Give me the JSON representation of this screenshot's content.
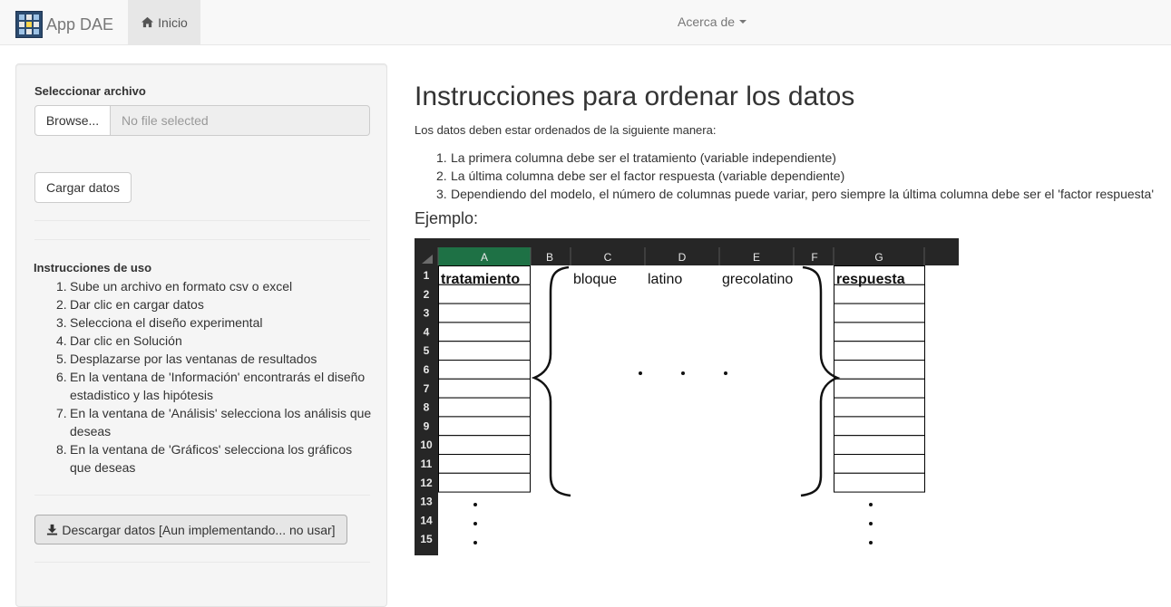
{
  "navbar": {
    "brand": "App DAE",
    "home_label": "Inicio",
    "about_label": "Acerca de",
    "home_icon": "home-icon",
    "about_icon": "caret-down-icon"
  },
  "sidebar": {
    "file_label": "Seleccionar archivo",
    "browse_label": "Browse...",
    "file_placeholder": "No file selected",
    "load_label": "Cargar datos",
    "instructions_title": "Instrucciones de uso",
    "instructions": [
      {
        "num": "1.",
        "text": "Sube un archivo en formato csv o excel"
      },
      {
        "num": "2.",
        "text": "Dar clic en cargar datos"
      },
      {
        "num": "3.",
        "text": "Selecciona el diseño experimental"
      },
      {
        "num": "4.",
        "text": "Dar clic en Solución"
      },
      {
        "num": "5.",
        "text": "Desplazarse por las ventanas de resultados"
      },
      {
        "num": "6.",
        "text": "En la ventana de 'Información' encontrarás el diseño estadistico y las hipótesis"
      },
      {
        "num": "7.",
        "text": "En la ventana de 'Análisis' selecciona los análisis que deseas"
      },
      {
        "num": "8.",
        "text": "En la ventana de 'Gráficos' selecciona los gráficos que deseas"
      }
    ],
    "download_label": "Descargar datos [Aun implementando... no usar]",
    "download_icon": "download-icon"
  },
  "main": {
    "title": "Instrucciones para ordenar los datos",
    "intro": "Los datos deben estar ordenados de la siguiente manera:",
    "rules": [
      {
        "num": "1.",
        "text": "La primera columna debe ser el tratamiento (variable independiente)"
      },
      {
        "num": "2.",
        "text": "La última columna debe ser el factor respuesta (variable dependiente)"
      },
      {
        "num": "3.",
        "text": "Dependiendo del modelo, el número de columnas puede variar, pero siempre la última columna debe ser el 'factor respuesta'"
      }
    ],
    "example_label": "Ejemplo:"
  },
  "sheet": {
    "columns": [
      "A",
      "B",
      "C",
      "D",
      "E",
      "F",
      "G"
    ],
    "rows": [
      "1",
      "2",
      "3",
      "4",
      "5",
      "6",
      "7",
      "8",
      "9",
      "10",
      "11",
      "12",
      "13",
      "14",
      "15"
    ],
    "headers": {
      "tratamiento": "tratamiento",
      "bloque": "bloque",
      "latino": "latino",
      "grecolatino": "grecolatino",
      "respuesta": "respuesta"
    },
    "header_bg": "#262626",
    "selected_col_bg": "#1e7145"
  },
  "colors": {
    "navbar_bg": "#f8f8f8",
    "sidebar_bg": "#f5f5f5",
    "active_nav_bg": "#e7e7e7"
  }
}
